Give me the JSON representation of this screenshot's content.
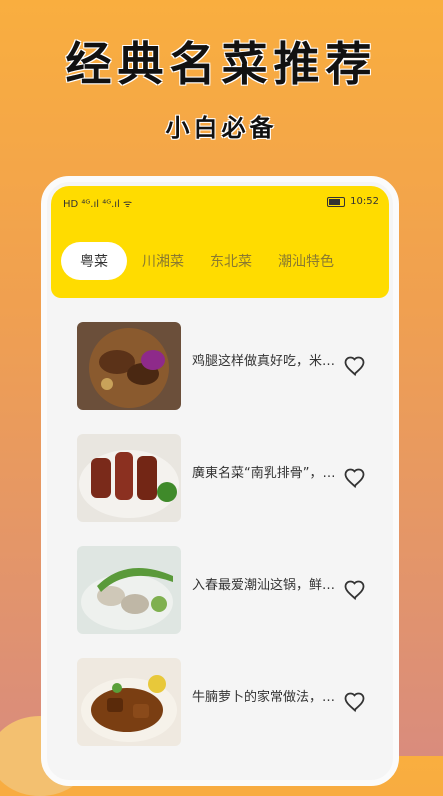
{
  "banner": {
    "title": "经典名菜推荐",
    "subtitle": "小白必备"
  },
  "status_bar": {
    "left_indicators": "HD ⁴ᴳ.ıl ⁴ᴳ.ıl ᯤ",
    "time": "10:52"
  },
  "tabs": [
    {
      "label": "粤菜",
      "active": true
    },
    {
      "label": "川湘菜",
      "active": false
    },
    {
      "label": "东北菜",
      "active": false
    },
    {
      "label": "潮汕特色",
      "active": false
    }
  ],
  "recipes": [
    {
      "title": "鸡腿这样做真好吃，米饭都不够吃了",
      "icon": "heart-outline-icon"
    },
    {
      "title": "廣東名菜“南乳排骨”，做法简单",
      "icon": "heart-outline-icon"
    },
    {
      "title": "入春最爱潮汕这锅，鲜美好喝",
      "icon": "heart-outline-icon"
    },
    {
      "title": "牛腩萝卜的家常做法，软烂入味",
      "icon": "heart-outline-icon"
    }
  ],
  "colors": {
    "header": "#ffdc00",
    "accent": "#f9ae3f"
  }
}
